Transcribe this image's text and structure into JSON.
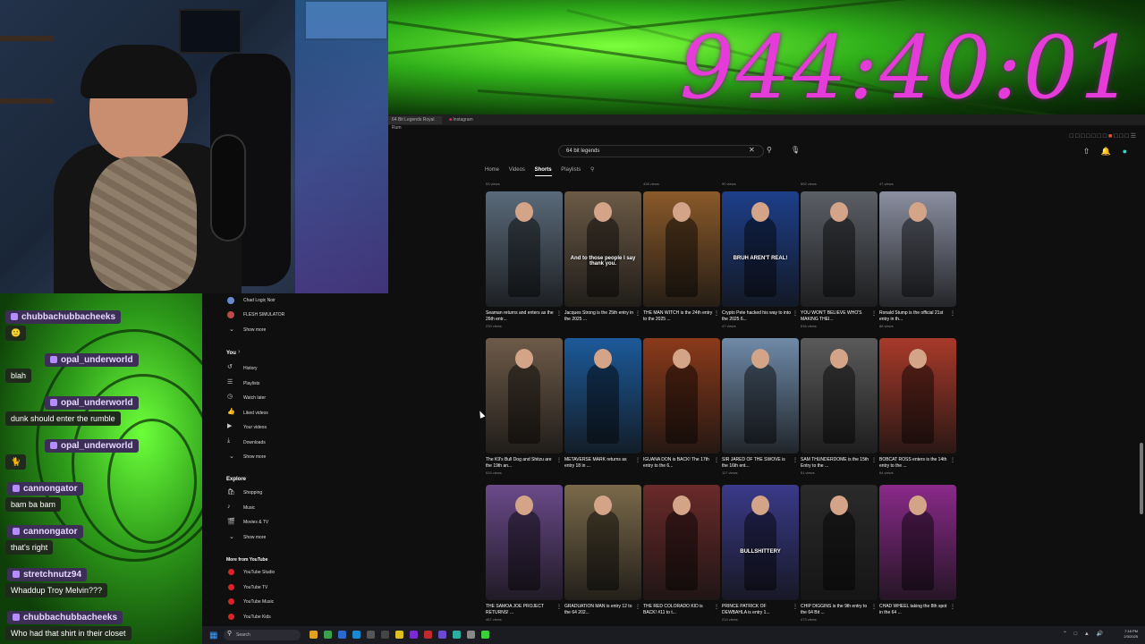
{
  "overlay": {
    "timer": "944:40:01"
  },
  "chat": {
    "messages": [
      {
        "user": "chubbachubbacheeks",
        "text": ""
      },
      {
        "user": "opal_underworld",
        "text": "blah"
      },
      {
        "user": "opal_underworld",
        "text": "dunk should enter the rumble"
      },
      {
        "user": "opal_underworld",
        "text": ""
      },
      {
        "user": "cannongator",
        "text": "bam ba bam"
      },
      {
        "user": "cannongator",
        "text": "that's right"
      },
      {
        "user": "stretchnutz94",
        "text": "Whaddup Troy Melvin???"
      },
      {
        "user": "chubbachubbacheeks",
        "text": "Who had that shirt in their closet"
      }
    ]
  },
  "browser": {
    "tabs": [
      "64 Bit Legends Royal Rum",
      "Instagram"
    ],
    "search_value": "64 bit legends",
    "channel_tabs": [
      "Home",
      "Videos",
      "Shorts",
      "Playlists"
    ],
    "active_tab": "Shorts"
  },
  "sidebar": {
    "subs": [
      "Chad Logic Noir",
      "FLESH SIMULATOR"
    ],
    "show_more": "Show more",
    "you_header": "You",
    "you_items": [
      "History",
      "Playlists",
      "Watch later",
      "Liked videos",
      "Your videos",
      "Downloads"
    ],
    "explore_header": "Explore",
    "explore_items": [
      "Shopping",
      "Music",
      "Movies & TV"
    ],
    "more_header": "More from YouTube",
    "more_items": [
      "YouTube Studio",
      "YouTube TV",
      "YouTube Music",
      "YouTube Kids"
    ]
  },
  "shorts": {
    "top_views": [
      "53 views",
      "",
      "428 views",
      "90 views",
      "592 views",
      "47 views"
    ],
    "rows": [
      [
        {
          "title": "Seaman returns and enters as the 26th entr...",
          "views": "230 views",
          "color": "#5a6a7a",
          "overlay": ""
        },
        {
          "title": "Jacques Strong is the 25th entry in the 2025 ...",
          "views": "",
          "color": "#6b5a46",
          "overlay": "And to those people I say thank you."
        },
        {
          "title": "THE MAN WITCH is the 24th entry to the 2025 ...",
          "views": "",
          "color": "#8a5a2a",
          "overlay": ""
        },
        {
          "title": "Crypto Pete hacked his way to into the 2025 6...",
          "views": "47 views",
          "color": "#1d3f8a",
          "overlay": "BRUH AREN'T REAL!"
        },
        {
          "title": "YOU WON'T BELIEVE WHO'S MAKING THEI...",
          "views": "516 views",
          "color": "#5b5f66",
          "overlay": ""
        },
        {
          "title": "Ronald Stump is the official 21st entry in th...",
          "views": "86 views",
          "color": "#8a8fa0",
          "overlay": ""
        }
      ],
      [
        {
          "title": "The K9's Bull Dog and Shitzu are the 19th an...",
          "views": "515 views",
          "color": "#6d5a48",
          "overlay": ""
        },
        {
          "title": "METAVERSE MARK returns as entry 18 in ...",
          "views": "",
          "color": "#1c5a9a",
          "overlay": ""
        },
        {
          "title": "IGUANA DON is BACK! The 17th entry to the 6...",
          "views": "",
          "color": "#8a3a1a",
          "overlay": ""
        },
        {
          "title": "SIR JARED OF THE SWOVE is the 16th ent...",
          "views": "117 views",
          "color": "#6f8aa8",
          "overlay": ""
        },
        {
          "title": "SAM THUNDERDOME is the 15th Entry to the ...",
          "views": "51 views",
          "color": "#5a5a5a",
          "overlay": ""
        },
        {
          "title": "BOBCAT ROSS enters is the 14th entry to the ...",
          "views": "64 views",
          "color": "#a83a2a",
          "overlay": ""
        }
      ],
      [
        {
          "title": "THE SAMOA JOE PROJECT RETURNS! ...",
          "views": "467 views",
          "color": "#6a4a8a",
          "overlay": ""
        },
        {
          "title": "GRADUATION MAN is entry 12 to the 64 202...",
          "views": "",
          "color": "#7a6a4a",
          "overlay": ""
        },
        {
          "title": "THE RED COLORADO KID is BACK! #11 to t...",
          "views": "",
          "color": "#6a2a2a",
          "overlay": ""
        },
        {
          "title": "PRINCE PATRICK OF DEWBAHLA is entry 1...",
          "views": "214 views",
          "color": "#3a3a8a",
          "overlay": "BULLSHITTERY"
        },
        {
          "title": "CHIP DIGGINS is the 9th entry to the 64 Bit ...",
          "views": "473 views",
          "color": "#2a2a2a",
          "overlay": ""
        },
        {
          "title": "CHAD WHEEL taking the 8th spot in the 64 ...",
          "views": "",
          "color": "#8a2a8a",
          "overlay": ""
        }
      ]
    ]
  },
  "taskbar": {
    "search_placeholder": "Search",
    "time": "7:18 PM",
    "date": "2/3/2025"
  }
}
